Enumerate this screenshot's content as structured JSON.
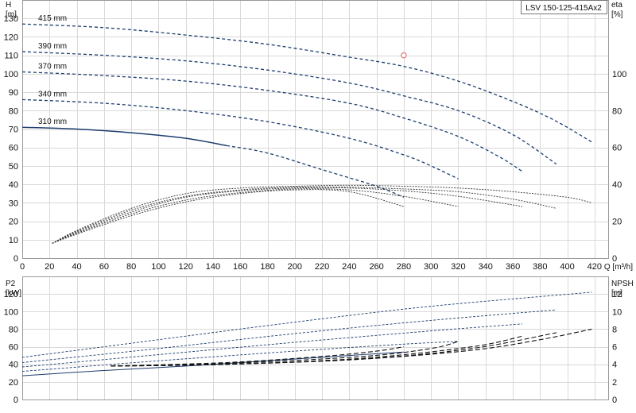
{
  "colors": {
    "curve": "#1d3d6e",
    "grid": "#d9d9d9",
    "marker": "#e05a5a",
    "axis": "#444444"
  },
  "chart_data": [
    {
      "type": "line",
      "title": "LSV 150-125-415Ax2",
      "xlabel": "Q [m³/h]",
      "ylabel_top": "H",
      "ylabel_bottom": "[m]",
      "y2label_top": "eta",
      "y2label_bottom": "[%]",
      "xlim": [
        0,
        430
      ],
      "ylim": [
        0,
        140
      ],
      "y2lim": [
        0,
        140
      ],
      "xticks": [
        0,
        20,
        40,
        60,
        80,
        100,
        120,
        140,
        160,
        180,
        200,
        220,
        240,
        260,
        280,
        300,
        320,
        340,
        360,
        380,
        400,
        420
      ],
      "yticks": [
        0,
        10,
        20,
        30,
        40,
        50,
        60,
        70,
        80,
        90,
        100,
        110,
        120,
        130
      ],
      "y2ticks": [
        0,
        20,
        40,
        60,
        80,
        100
      ],
      "grid": true,
      "series": [
        {
          "name": "415 mm",
          "axis": "left",
          "style": "dashed",
          "x": [
            0,
            60,
            120,
            180,
            240,
            280,
            320,
            360,
            390,
            418
          ],
          "y": [
            127,
            125,
            121,
            116,
            109,
            104,
            96,
            85,
            75,
            63
          ]
        },
        {
          "name": "390 mm",
          "axis": "left",
          "style": "dashed",
          "x": [
            0,
            60,
            120,
            180,
            240,
            280,
            320,
            360,
            392
          ],
          "y": [
            112,
            110,
            107,
            102,
            95,
            88,
            80,
            67,
            51
          ]
        },
        {
          "name": "370 mm",
          "axis": "left",
          "style": "dashed",
          "x": [
            0,
            60,
            120,
            180,
            240,
            280,
            320,
            350,
            367
          ],
          "y": [
            101,
            99,
            96,
            91,
            84,
            76,
            66,
            55,
            47
          ]
        },
        {
          "name": "340 mm",
          "axis": "left",
          "style": "dashed",
          "x": [
            0,
            60,
            120,
            180,
            240,
            280,
            300,
            320
          ],
          "y": [
            86,
            84,
            80,
            74,
            65,
            56,
            50,
            43
          ]
        },
        {
          "name": "310 mm",
          "axis": "left",
          "style": "solid-then-dashed",
          "x": [
            0,
            40,
            80,
            120,
            150,
            180,
            220,
            260,
            280
          ],
          "y": [
            71,
            70,
            68,
            65,
            61,
            57,
            48,
            39,
            33
          ]
        },
        {
          "name": "",
          "axis": "right",
          "style": "eta",
          "x": [
            22,
            40,
            80,
            120,
            160,
            200,
            240,
            280,
            320,
            360,
            400,
            418
          ],
          "y": [
            8,
            15,
            27,
            35,
            38,
            39,
            39.5,
            39,
            38,
            36,
            33,
            30
          ]
        },
        {
          "name": "",
          "axis": "right",
          "style": "eta",
          "x": [
            22,
            40,
            80,
            120,
            160,
            200,
            240,
            280,
            320,
            360,
            392
          ],
          "y": [
            8,
            14.5,
            26,
            33.5,
            37,
            38.5,
            38.5,
            37.5,
            36,
            32,
            27
          ]
        },
        {
          "name": "",
          "axis": "right",
          "style": "eta",
          "x": [
            22,
            40,
            80,
            120,
            160,
            200,
            240,
            280,
            320,
            367
          ],
          "y": [
            8,
            14,
            25,
            33,
            36.5,
            38,
            38,
            36.5,
            33.5,
            28
          ]
        },
        {
          "name": "",
          "axis": "right",
          "style": "eta",
          "x": [
            22,
            40,
            80,
            120,
            160,
            200,
            240,
            280,
            320
          ],
          "y": [
            8,
            13.5,
            24,
            31.5,
            35.5,
            37.5,
            37,
            33.5,
            28
          ]
        },
        {
          "name": "",
          "axis": "right",
          "style": "eta",
          "x": [
            22,
            40,
            80,
            120,
            160,
            200,
            240,
            280
          ],
          "y": [
            8,
            13,
            23,
            30.5,
            35,
            37,
            36,
            28
          ]
        }
      ],
      "operating_point": {
        "x": 280,
        "y": 110
      }
    },
    {
      "type": "line",
      "xlabel": "",
      "ylabel_top": "P2",
      "ylabel_bottom": "[kW]",
      "y2label_top": "NPSH",
      "y2label_bottom": "[m]",
      "xlim": [
        0,
        430
      ],
      "ylim": [
        0,
        140
      ],
      "y2lim": [
        0,
        14
      ],
      "xticks": [
        0,
        20,
        40,
        60,
        80,
        100,
        120,
        140,
        160,
        180,
        200,
        220,
        240,
        260,
        280,
        300,
        320,
        340,
        360,
        380,
        400,
        420
      ],
      "yticks": [
        0,
        20,
        40,
        60,
        80,
        100,
        120
      ],
      "y2ticks": [
        0,
        2,
        4,
        6,
        8,
        10,
        12
      ],
      "grid": true,
      "series": [
        {
          "name": "",
          "axis": "left",
          "style": "thin-dashed",
          "x": [
            0,
            100,
            200,
            300,
            418
          ],
          "y": [
            48,
            68,
            88,
            106,
            122
          ]
        },
        {
          "name": "",
          "axis": "left",
          "style": "thin-dashed",
          "x": [
            0,
            100,
            200,
            300,
            392
          ],
          "y": [
            42,
            58,
            75,
            90,
            102
          ]
        },
        {
          "name": "",
          "axis": "left",
          "style": "thin-dashed",
          "x": [
            0,
            100,
            200,
            300,
            367
          ],
          "y": [
            37,
            51,
            65,
            78,
            86
          ]
        },
        {
          "name": "",
          "axis": "left",
          "style": "thin-dashed",
          "x": [
            0,
            100,
            200,
            280,
            320
          ],
          "y": [
            32,
            44,
            55,
            63,
            66
          ]
        },
        {
          "name": "",
          "axis": "left",
          "style": "thin",
          "x": [
            0,
            60,
            120,
            180,
            220,
            260,
            280
          ],
          "y": [
            27,
            33,
            38,
            44,
            48,
            52,
            54
          ]
        },
        {
          "name": "",
          "axis": "right",
          "style": "npsh-dashed",
          "x": [
            65,
            150,
            250,
            330,
            380,
            418
          ],
          "y": [
            3.8,
            4.0,
            4.6,
            5.6,
            6.8,
            8.0
          ]
        },
        {
          "name": "",
          "axis": "right",
          "style": "npsh-dashed",
          "x": [
            65,
            150,
            250,
            330,
            392
          ],
          "y": [
            3.8,
            4.0,
            4.6,
            5.8,
            7.6
          ]
        },
        {
          "name": "",
          "axis": "right",
          "style": "npsh-dashed",
          "x": [
            65,
            150,
            250,
            330,
            367
          ],
          "y": [
            3.8,
            4.0,
            4.7,
            6.0,
            7.2
          ]
        },
        {
          "name": "",
          "axis": "right",
          "style": "npsh-dashed",
          "x": [
            65,
            150,
            250,
            300,
            320
          ],
          "y": [
            3.8,
            4.1,
            4.9,
            5.8,
            6.6
          ]
        },
        {
          "name": "",
          "axis": "right",
          "style": "npsh-dashed",
          "x": [
            65,
            150,
            220,
            260,
            280
          ],
          "y": [
            3.8,
            4.2,
            4.9,
            5.5,
            6.0
          ]
        }
      ]
    }
  ]
}
